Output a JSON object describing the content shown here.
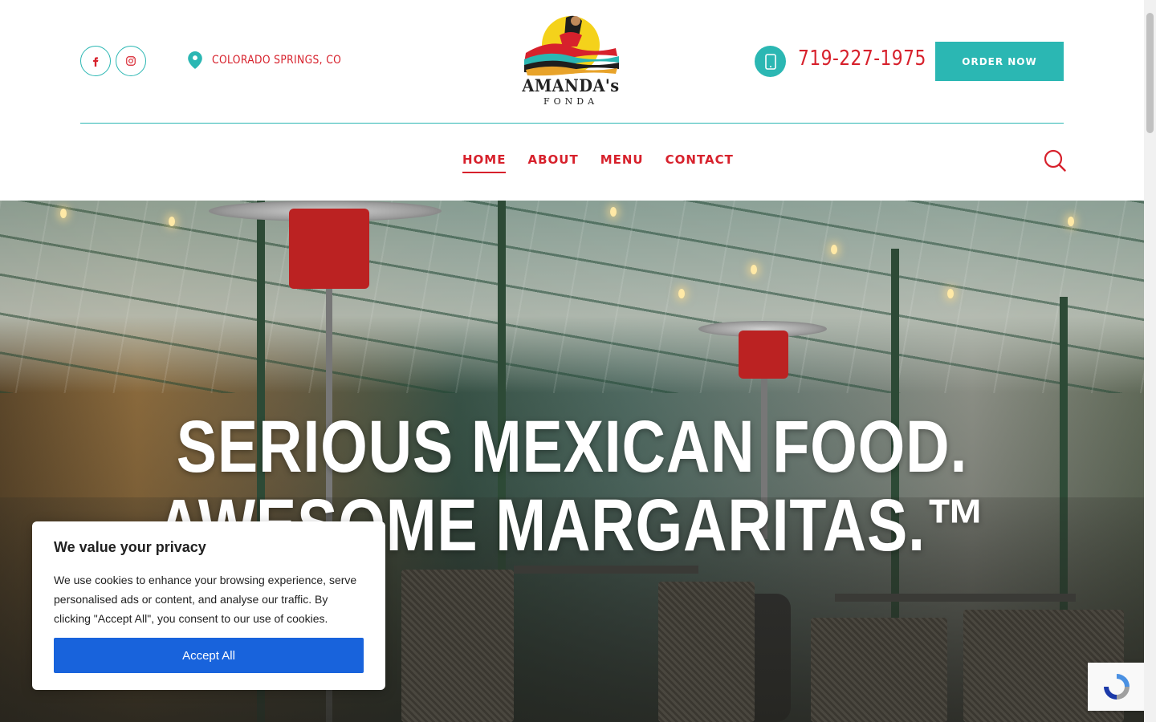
{
  "header": {
    "location": "COLORADO SPRINGS, CO",
    "phone": "719-227-1975",
    "order_button": "ORDER NOW",
    "logo": {
      "title": "AMANDA's",
      "subtitle": "FONDA"
    },
    "social": [
      "facebook-icon",
      "instagram-icon"
    ]
  },
  "nav": {
    "items": [
      "HOME",
      "ABOUT",
      "MENU",
      "CONTACT"
    ],
    "active": "HOME"
  },
  "hero": {
    "line1": "SERIOUS MEXICAN FOOD.",
    "line2": "AWESOME MARGARITAS.™"
  },
  "cookie": {
    "title": "We value your privacy",
    "text": "We use cookies to enhance your browsing experience, serve personalised ads or content, and analyse our traffic. By clicking \"Accept All\", you consent to our use of cookies.",
    "accept": "Accept All"
  },
  "colors": {
    "accent_red": "#d7212c",
    "accent_teal": "#2bb7b3",
    "accept_blue": "#1863dc"
  }
}
